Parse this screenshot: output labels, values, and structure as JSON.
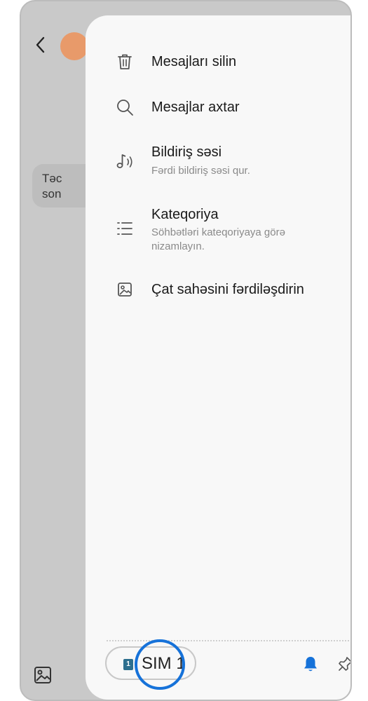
{
  "background": {
    "bubble_text_line1": "Təc",
    "bubble_text_line2": "son"
  },
  "menu": {
    "items": [
      {
        "title": "Mesajları silin",
        "icon": "trash-icon"
      },
      {
        "title": "Mesajlar axtar",
        "icon": "search-icon"
      },
      {
        "title": "Bildiriş səsi",
        "subtitle": "Fərdi bildiriş səsi qur.",
        "icon": "music-note-icon"
      },
      {
        "title": "Kateqoriya",
        "subtitle_line1": "Söhbətləri kateqoriyaya görə",
        "subtitle_line2": "nizamlayın.",
        "icon": "list-icon"
      },
      {
        "title": "Çat sahəsini fərdiləşdirin",
        "icon": "image-icon"
      }
    ]
  },
  "footer": {
    "sim_chip": "1",
    "sim_label": "SIM 1",
    "bell_icon": "bell-icon",
    "pin_icon": "pin-icon"
  },
  "colors": {
    "accent": "#1672d9",
    "drawer_bg": "#f8f8f8",
    "dim_bg": "#c9c9c9"
  }
}
